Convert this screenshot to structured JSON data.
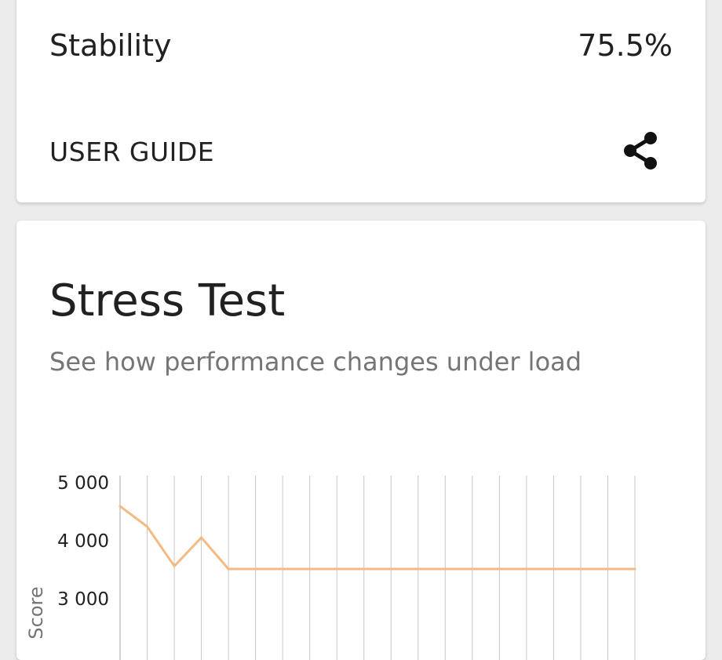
{
  "stats": {
    "stability_label": "Stability",
    "stability_value": "75.5%"
  },
  "actions": {
    "user_guide_label": "USER GUIDE",
    "share_icon": "share-icon"
  },
  "stress_test": {
    "title": "Stress Test",
    "subtitle": "See how performance changes under load"
  },
  "colors": {
    "line": "#f1bb83",
    "grid": "#c8c8c8",
    "text_primary": "#212121",
    "text_secondary": "#757575"
  },
  "chart_data": {
    "type": "line",
    "title": "",
    "xlabel": "",
    "ylabel": "Score",
    "x": [
      0,
      1,
      2,
      3,
      4,
      5,
      6,
      7,
      8,
      9,
      10,
      11,
      12,
      13,
      14,
      15,
      16,
      17,
      18,
      19
    ],
    "series": [
      {
        "values": [
          4580,
          4230,
          3550,
          4040,
          3500,
          3500,
          3500,
          3500,
          3500,
          3500,
          3500,
          3500,
          3500,
          3500,
          3500,
          3500,
          3500,
          3500,
          3500,
          3500
        ]
      }
    ],
    "yticks": [
      "5 000",
      "4 000",
      "3 000"
    ],
    "ytick_values": [
      5000,
      4000,
      3000
    ],
    "ylim": [
      2000,
      5000
    ],
    "grid": "vertical"
  }
}
